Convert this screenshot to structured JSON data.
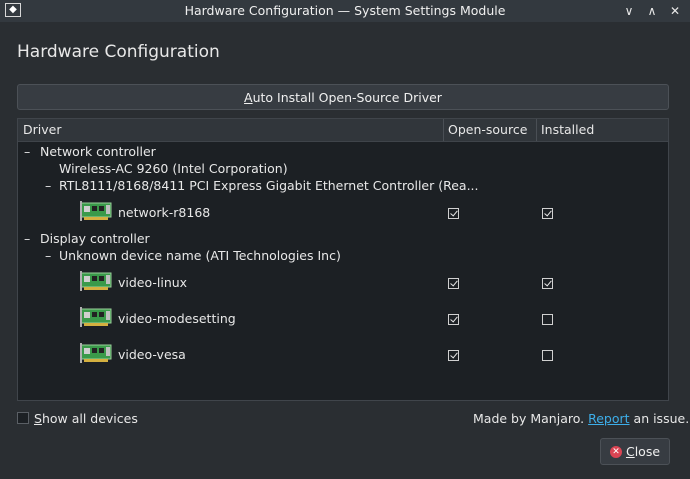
{
  "window": {
    "title": "Hardware Configuration — System Settings Module",
    "min_glyph": "∨",
    "max_glyph": "∧",
    "close_glyph": "✕"
  },
  "heading": "Hardware Configuration",
  "auto_install": {
    "accel": "A",
    "label_rest": "uto Install Open-Source Driver"
  },
  "tree": {
    "columns": [
      "Driver",
      "Open-source",
      "Installed"
    ],
    "rows": {
      "network_controller": "Network controller",
      "wireless": "Wireless-AC 9260 (Intel Corporation)",
      "rtl": "RTL8111/8168/8411 PCI Express Gigabit Ethernet Controller (Rea...",
      "network_r8168": "network-r8168",
      "display_controller": "Display controller",
      "unknown_device": "Unknown device name (ATI Technologies Inc)",
      "video_linux": "video-linux",
      "video_modesetting": "video-modesetting",
      "video_vesa": "video-vesa"
    },
    "expander_open": "–",
    "drivers": [
      {
        "name": "network-r8168",
        "open_source": true,
        "installed": true
      },
      {
        "name": "video-linux",
        "open_source": true,
        "installed": true
      },
      {
        "name": "video-modesetting",
        "open_source": true,
        "installed": false
      },
      {
        "name": "video-vesa",
        "open_source": true,
        "installed": false
      }
    ]
  },
  "show_all": {
    "accel": "S",
    "label_rest": "how all devices",
    "checked": false
  },
  "footer": {
    "prefix": "Made by Manjaro.",
    "link": "Report",
    "suffix": "an issue."
  },
  "close_button": {
    "accel": "C",
    "label_rest": "lose"
  },
  "icons": {
    "driver": "network-card-icon",
    "close": "close-circle-icon"
  },
  "colors": {
    "background": "#2a2e32",
    "link": "#3daee9",
    "close_icon": "#da4453"
  }
}
